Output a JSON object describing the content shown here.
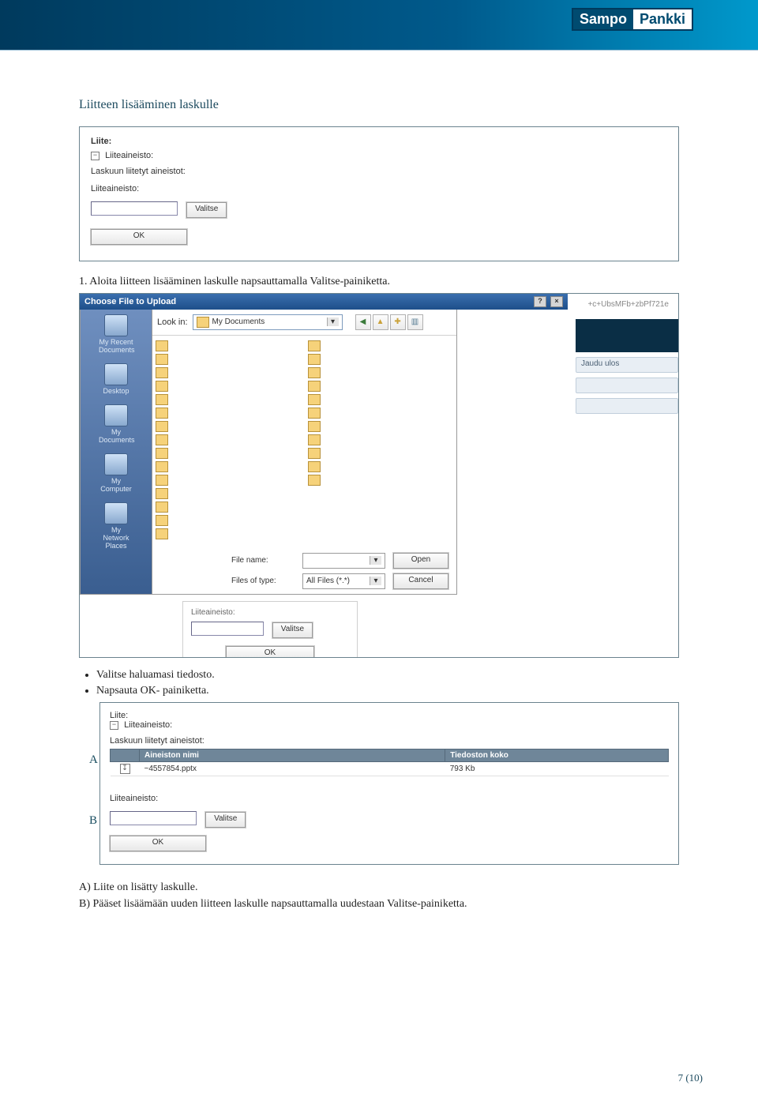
{
  "logo": {
    "left": "Sampo",
    "right": "Pankki"
  },
  "heading": "Liitteen lisääminen laskulle",
  "box1": {
    "title": "Liite:",
    "collapse_label": "Liiteaineisto:",
    "attached_label": "Laskuun liitetyt aineistot:",
    "section_label": "Liiteaineisto:",
    "valitse_btn": "Valitse",
    "ok_btn": "OK"
  },
  "step1": "1. Aloita liitteen lisääminen laskulle napsauttamalla Valitse-painiketta.",
  "dialog": {
    "title": "Choose File to Upload",
    "addr_hint": "+c+UbsMFb+zbPf721e",
    "lookin_label": "Look in:",
    "lookin_value": "My Documents",
    "toolbar_icons": [
      "back-icon",
      "up-icon",
      "new-folder-icon",
      "views-icon"
    ],
    "side": [
      {
        "name": "recent",
        "label": "My Recent Documents"
      },
      {
        "name": "desktop",
        "label": "Desktop"
      },
      {
        "name": "mydocs",
        "label": "My Documents"
      },
      {
        "name": "mycomp",
        "label": "My Computer"
      },
      {
        "name": "network",
        "label": "My Network Places"
      }
    ],
    "file_name_label": "File name:",
    "file_type_label": "Files of type:",
    "file_type_value": "All Files (*.*)",
    "open_btn": "Open",
    "cancel_btn": "Cancel",
    "right_pill": "Jaudu ulos",
    "inner": {
      "label": "Liiteaineisto:",
      "valitse": "Valitse",
      "ok": "OK"
    }
  },
  "bullets": [
    "Valitse haluamasi tiedosto.",
    "Napsauta OK- painiketta."
  ],
  "box3": {
    "marker_a": "A",
    "marker_b": "B",
    "title": "Liite:",
    "collapse_label": "Liiteaineisto:",
    "attached_label": "Laskuun liitetyt aineistot:",
    "col_name": "Aineiston nimi",
    "col_size": "Tiedoston koko",
    "rows": [
      {
        "name": "~4557854.pptx",
        "size": "793 Kb"
      }
    ],
    "section_label": "Liiteaineisto:",
    "valitse_btn": "Valitse",
    "ok_btn": "OK"
  },
  "explain_a": "A) Liite on lisätty laskulle.",
  "explain_b": "B) Pääset lisäämään uuden liitteen laskulle napsauttamalla uudestaan Valitse-painiketta.",
  "pagenum": "7 (10)"
}
